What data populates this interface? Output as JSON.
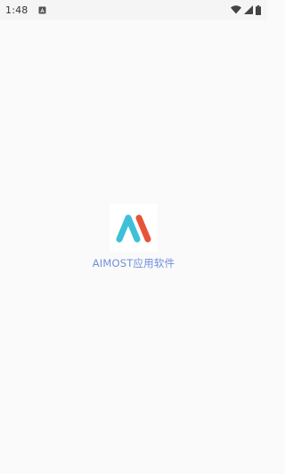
{
  "status_bar": {
    "time": "1:48",
    "notification_icon": "a-notification-icon",
    "wifi_icon": "wifi-icon",
    "signal_icon": "cellular-signal-icon",
    "battery_icon": "battery-icon"
  },
  "splash": {
    "logo_icon": "aimost-logo-icon",
    "app_name": "AIMOST应用软件",
    "colors": {
      "logo_cyan": "#3ec0d8",
      "logo_orange": "#e8543a",
      "name_text": "#6f8fdc",
      "background": "#fafafa"
    }
  }
}
